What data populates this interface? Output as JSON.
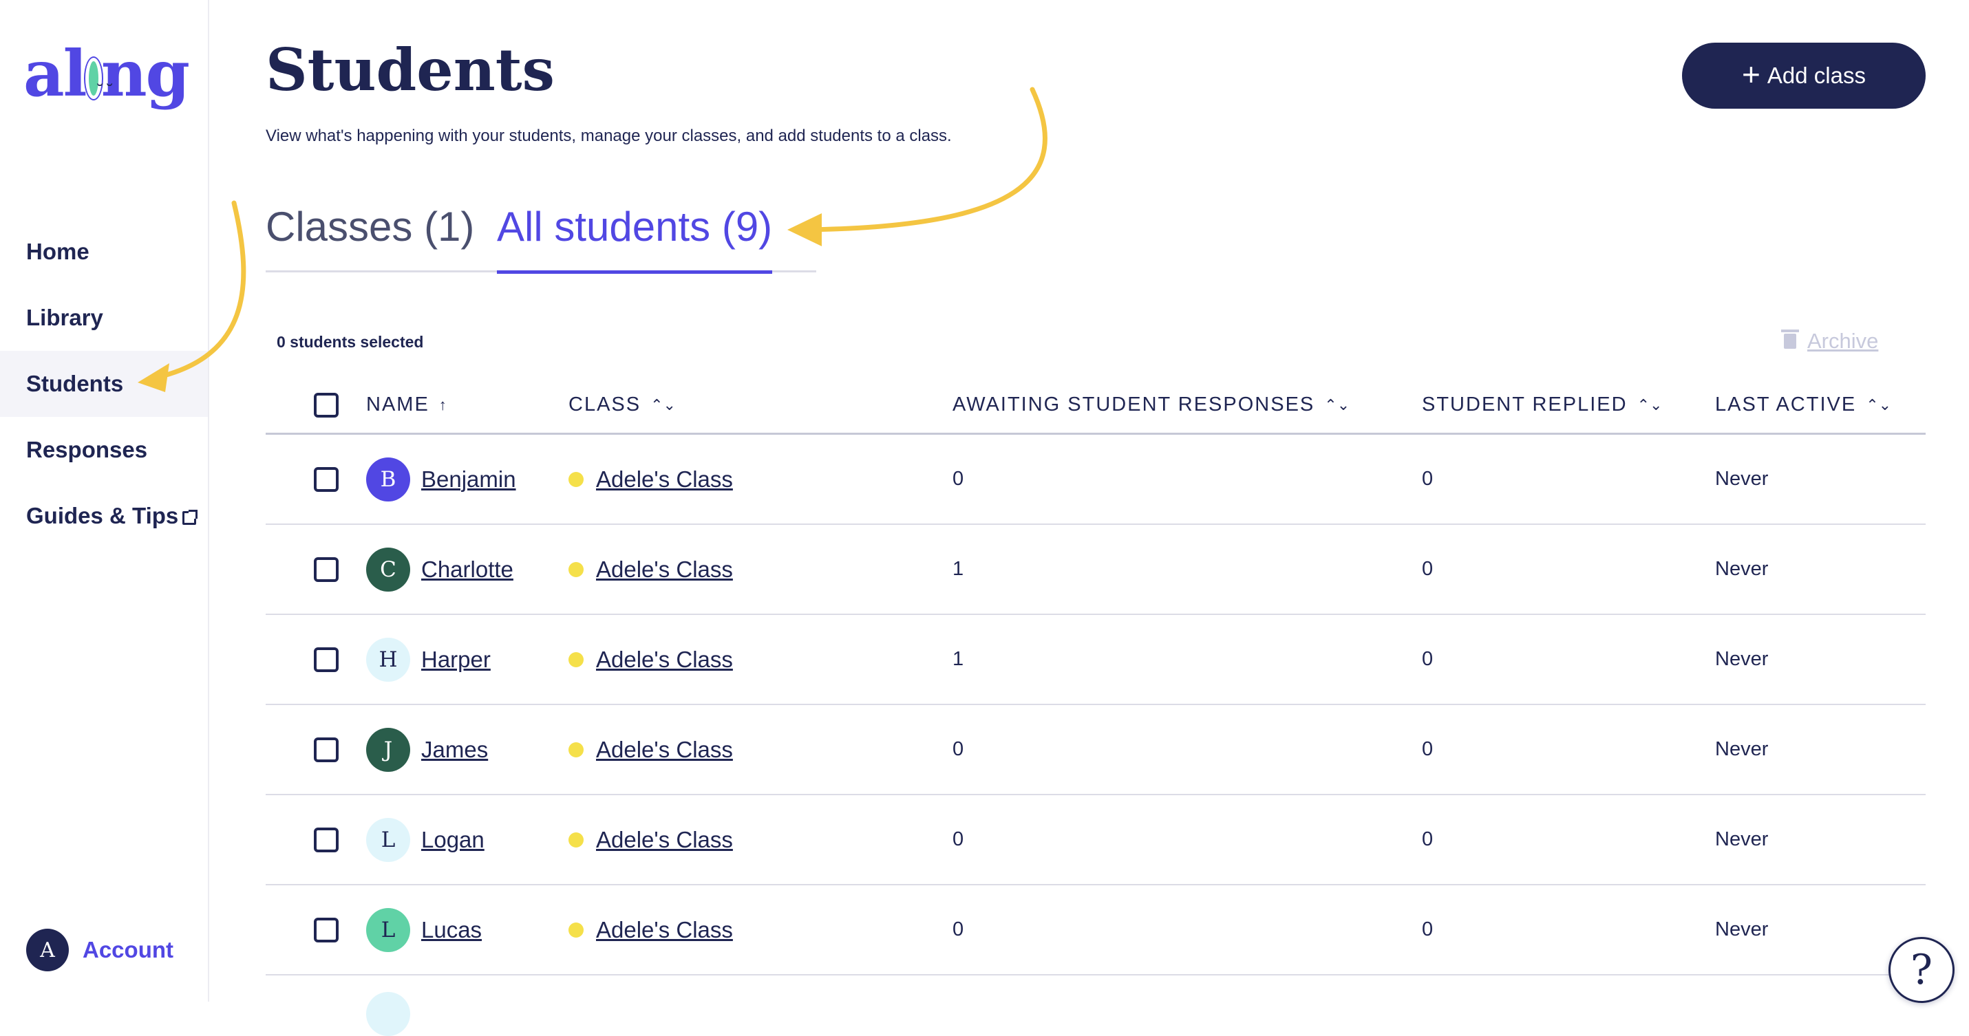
{
  "brand": {
    "logo_left": "al",
    "logo_right": "ng",
    "color": "#5147e3",
    "sun_color": "#60d2a6"
  },
  "sidebar": {
    "items": [
      {
        "label": "Home"
      },
      {
        "label": "Library"
      },
      {
        "label": "Students",
        "active": true
      },
      {
        "label": "Responses"
      },
      {
        "label": "Guides & Tips",
        "external": true
      }
    ],
    "account": {
      "initial": "A",
      "label": "Account"
    }
  },
  "header": {
    "title": "Students",
    "subtitle": "View what's happening with your students, manage your classes, and add students to a class.",
    "add_class_icon": "+",
    "add_class_label": "Add class"
  },
  "tabs": [
    {
      "label": "Classes (1)",
      "active": false
    },
    {
      "label": "All students (9)",
      "active": true
    }
  ],
  "toolbar": {
    "selected_text": "0 students selected",
    "archive_label": "Archive"
  },
  "table": {
    "columns": [
      {
        "label": "NAME",
        "sort_icon": "↑"
      },
      {
        "label": "CLASS",
        "sort_icon": "⌃⌄"
      },
      {
        "label": "AWAITING STUDENT RESPONSES",
        "sort_icon": "⌃⌄"
      },
      {
        "label": "STUDENT REPLIED",
        "sort_icon": "⌃⌄"
      },
      {
        "label": "LAST ACTIVE",
        "sort_icon": "⌃⌄"
      }
    ],
    "rows": [
      {
        "initial": "B",
        "name": "Benjamin",
        "avatar_bg": "#5147e3",
        "avatar_fg": "#ffffff",
        "class": "Adele's Class",
        "class_color": "#f5e04a",
        "awaiting": "0",
        "replied": "0",
        "last_active": "Never"
      },
      {
        "initial": "C",
        "name": "Charlotte",
        "avatar_bg": "#2a5d4b",
        "avatar_fg": "#ffffff",
        "class": "Adele's Class",
        "class_color": "#f5e04a",
        "awaiting": "1",
        "replied": "0",
        "last_active": "Never"
      },
      {
        "initial": "H",
        "name": "Harper",
        "avatar_bg": "#e0f5fb",
        "avatar_fg": "#1f2552",
        "class": "Adele's Class",
        "class_color": "#f5e04a",
        "awaiting": "1",
        "replied": "0",
        "last_active": "Never"
      },
      {
        "initial": "J",
        "name": "James",
        "avatar_bg": "#2a5d4b",
        "avatar_fg": "#ffffff",
        "class": "Adele's Class",
        "class_color": "#f5e04a",
        "awaiting": "0",
        "replied": "0",
        "last_active": "Never"
      },
      {
        "initial": "L",
        "name": "Logan",
        "avatar_bg": "#e0f5fb",
        "avatar_fg": "#1f2552",
        "class": "Adele's Class",
        "class_color": "#f5e04a",
        "awaiting": "0",
        "replied": "0",
        "last_active": "Never"
      },
      {
        "initial": "L",
        "name": "Lucas",
        "avatar_bg": "#60d2a6",
        "avatar_fg": "#1f2552",
        "class": "Adele's Class",
        "class_color": "#f5e04a",
        "awaiting": "0",
        "replied": "0",
        "last_active": "Never"
      }
    ]
  },
  "help": {
    "icon": "?"
  },
  "annotation_color": "#f4c542"
}
